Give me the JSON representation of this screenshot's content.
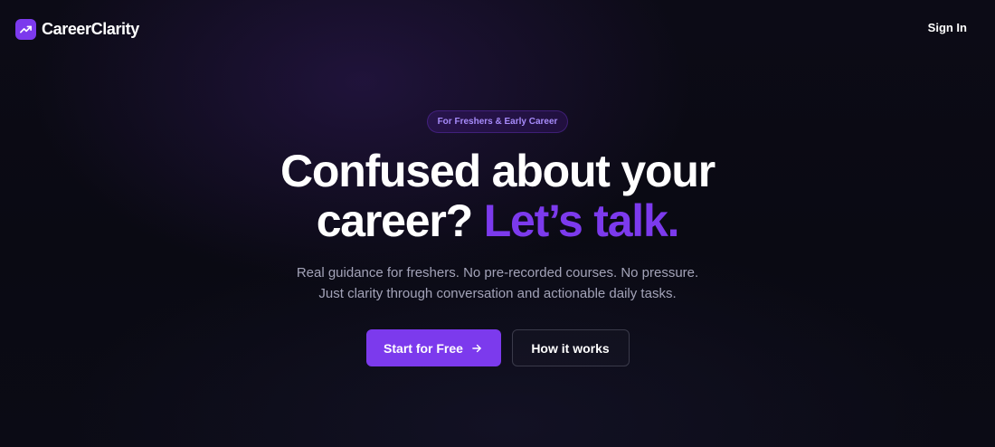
{
  "nav": {
    "brand_name": "CareerClarity",
    "brand_icon": "trending-up-icon",
    "sign_in_label": "Sign In"
  },
  "hero": {
    "badge_text": "For Freshers & Early Career",
    "headline_line1": "Confused about your",
    "headline_line2_plain": "career?",
    "headline_line2_accent": "Let’s talk.",
    "subtext_line1": "Real guidance for freshers. No pre-recorded courses. No pressure.",
    "subtext_line2": "Just clarity through conversation and actionable daily tasks.",
    "primary_cta_label": "Start for Free",
    "primary_cta_icon": "arrow-right-icon",
    "secondary_cta_label": "How it works"
  },
  "colors": {
    "accent": "#7c3aed",
    "badge_text": "#a78bfa",
    "background": "#0b0b15",
    "subtext": "#a3a3b8"
  }
}
